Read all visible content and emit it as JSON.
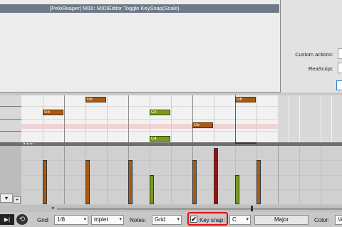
{
  "action_list": {
    "selected_action": "[PeloReaper] MIDI: MIDIEditor Toggle KeySnap(Scale)"
  },
  "right_dialog": {
    "custom_actions_label": "Custom actions:",
    "rescript_label": "ReaScript:"
  },
  "notes": [
    {
      "label": "G6",
      "color": "orange"
    },
    {
      "label": "G5",
      "color": "orange"
    },
    {
      "label": "C4",
      "color": "green"
    },
    {
      "label": "C4",
      "color": "green"
    },
    {
      "label": "G5",
      "color": "orange"
    },
    {
      "label": "G6",
      "color": "orange"
    }
  ],
  "velocity": [
    {
      "color": "orange",
      "level": 0.78
    },
    {
      "color": "orange",
      "level": 0.78
    },
    {
      "color": "orange",
      "level": 0.78
    },
    {
      "color": "green",
      "level": 0.52
    },
    {
      "color": "orange",
      "level": 0.78
    },
    {
      "color": "red",
      "level": 1.0
    },
    {
      "color": "green",
      "level": 0.52
    },
    {
      "color": "orange",
      "level": 0.78
    }
  ],
  "lane": {
    "dropdown_icon": "chevron-down-icon",
    "add_icon": "plus-icon"
  },
  "toolbar": {
    "grid_label": "Grid:",
    "grid_value": "1/8",
    "grid_type": "triplet",
    "notes_label": "Notes:",
    "notes_value": "Grid",
    "keysnap_label": "Key snap:",
    "keysnap_checked": "✔",
    "key_value": "C",
    "scale_value": "Major",
    "color_label": "Color:",
    "color_value": "Ve",
    "transport_glyph": "▶|",
    "loop_glyph": "⟲",
    "chevron": "▾"
  },
  "colors": {
    "highlight": "#e01010",
    "note_orange": "#a85a12",
    "note_green": "#7a9a20",
    "velocity_red": "#9a1010",
    "playhead": "#c03030"
  }
}
